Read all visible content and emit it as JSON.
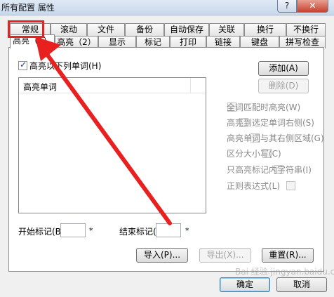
{
  "window": {
    "title": "所有配置 属性",
    "help_label": "?",
    "close_label": "✕"
  },
  "tabs_row1": [
    "常规",
    "滚动",
    "文件",
    "备份",
    "自动保存",
    "关联",
    "换行",
    "不换行"
  ],
  "tabs_row2": [
    "高亮（1）",
    "高亮（2）",
    "显示",
    "标记",
    "打印",
    "链接",
    "键盘",
    "拼写检查"
  ],
  "panel": {
    "enable_checkbox_label": "高亮以下列单词(H)",
    "list_header": "高亮单词",
    "add_button": "添加(A)",
    "delete_button": "删除(D)",
    "options": [
      "全词匹配时高亮(W)",
      "高亮到选定单词右侧(S)",
      "高亮单词与其右侧区域(G)",
      "区分大小写(C)",
      "只高亮标记内字符串(I)",
      "正则表达式(L)"
    ],
    "start_mark_label": "开始标记(B)",
    "end_mark_label": "结束标记(",
    "asterisk": "*",
    "import_button": "导入(P)...",
    "export_button": "导出(X)...",
    "reset_button": "重置(R)..."
  },
  "footer": {
    "ok_button": "确定",
    "cancel_button": "取消"
  },
  "watermark": "Bai 经验 jingyan.baidu.com",
  "colors": {
    "annotation_red": "#e8201f",
    "titlebar": "#c9d8ea",
    "dialog_bg": "#f0f0f0"
  }
}
